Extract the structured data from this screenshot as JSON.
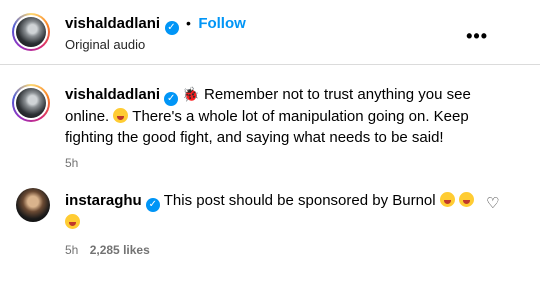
{
  "header": {
    "username": "vishaldadlani",
    "separator": "•",
    "follow_label": "Follow",
    "subtitle": "Original audio",
    "more_icon": "•••"
  },
  "comments": [
    {
      "username": "vishaldadlani",
      "bug_icon": "🐞",
      "text_1": "Remember not to trust anything you see",
      "text_2": "online.",
      "text_3": "There's a whole lot of manipulation going on. Keep",
      "text_4": "fighting the good fight, and saying what needs to be said!",
      "time": "5h"
    },
    {
      "username": "instaraghu",
      "text_1": "This post should be sponsored by Burnol",
      "time": "5h",
      "likes": "2,285 likes",
      "heart_icon": "♡"
    }
  ],
  "colors": {
    "accent": "#0095f6",
    "muted": "#737373"
  }
}
